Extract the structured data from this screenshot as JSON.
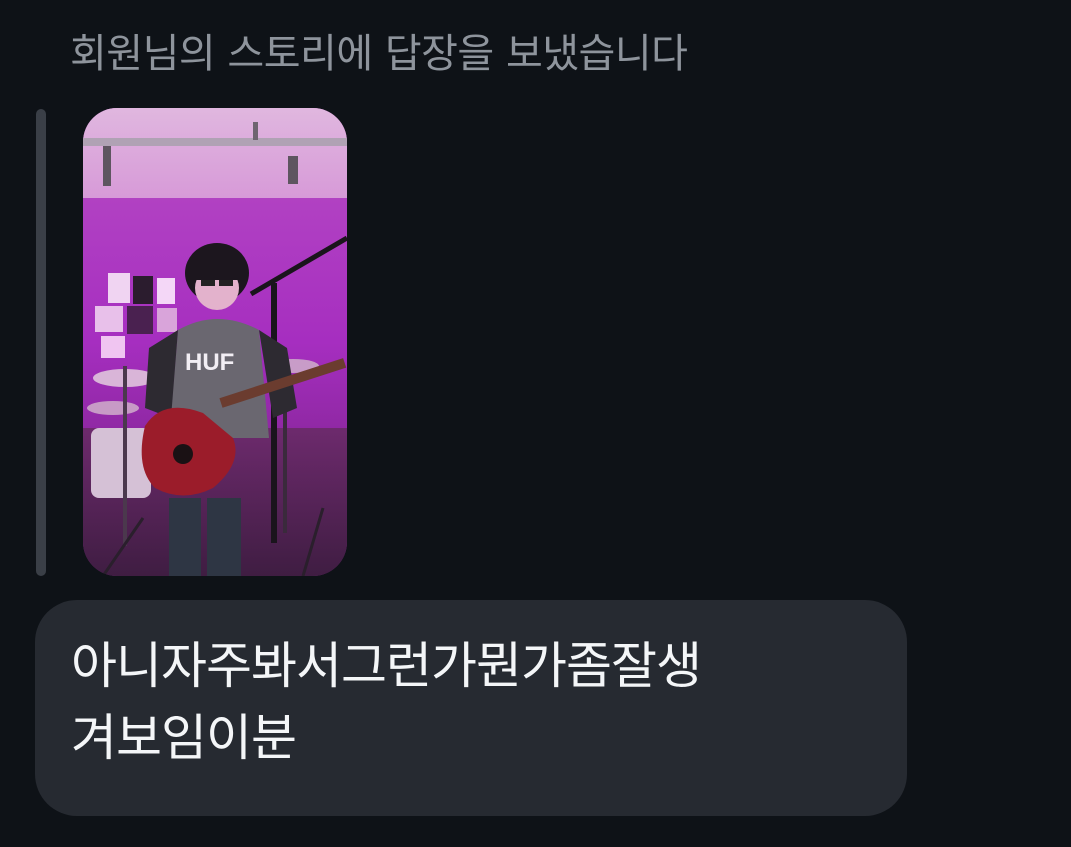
{
  "conversation": {
    "reply_context": "회원님의 스토리에 답장을 보냈습니다",
    "story_thumbnail": {
      "description_icon": "story-photo",
      "shirt_text": "HUF"
    },
    "message": {
      "line1": "아니자주봐서그런가뭔가좀잘생",
      "line2": "겨보임이분"
    }
  },
  "colors": {
    "background": "#0e1217",
    "bubble": "#262a31",
    "header_text": "#8e949c",
    "message_text": "#f4f6f8",
    "reply_bar": "#3a3f47"
  }
}
